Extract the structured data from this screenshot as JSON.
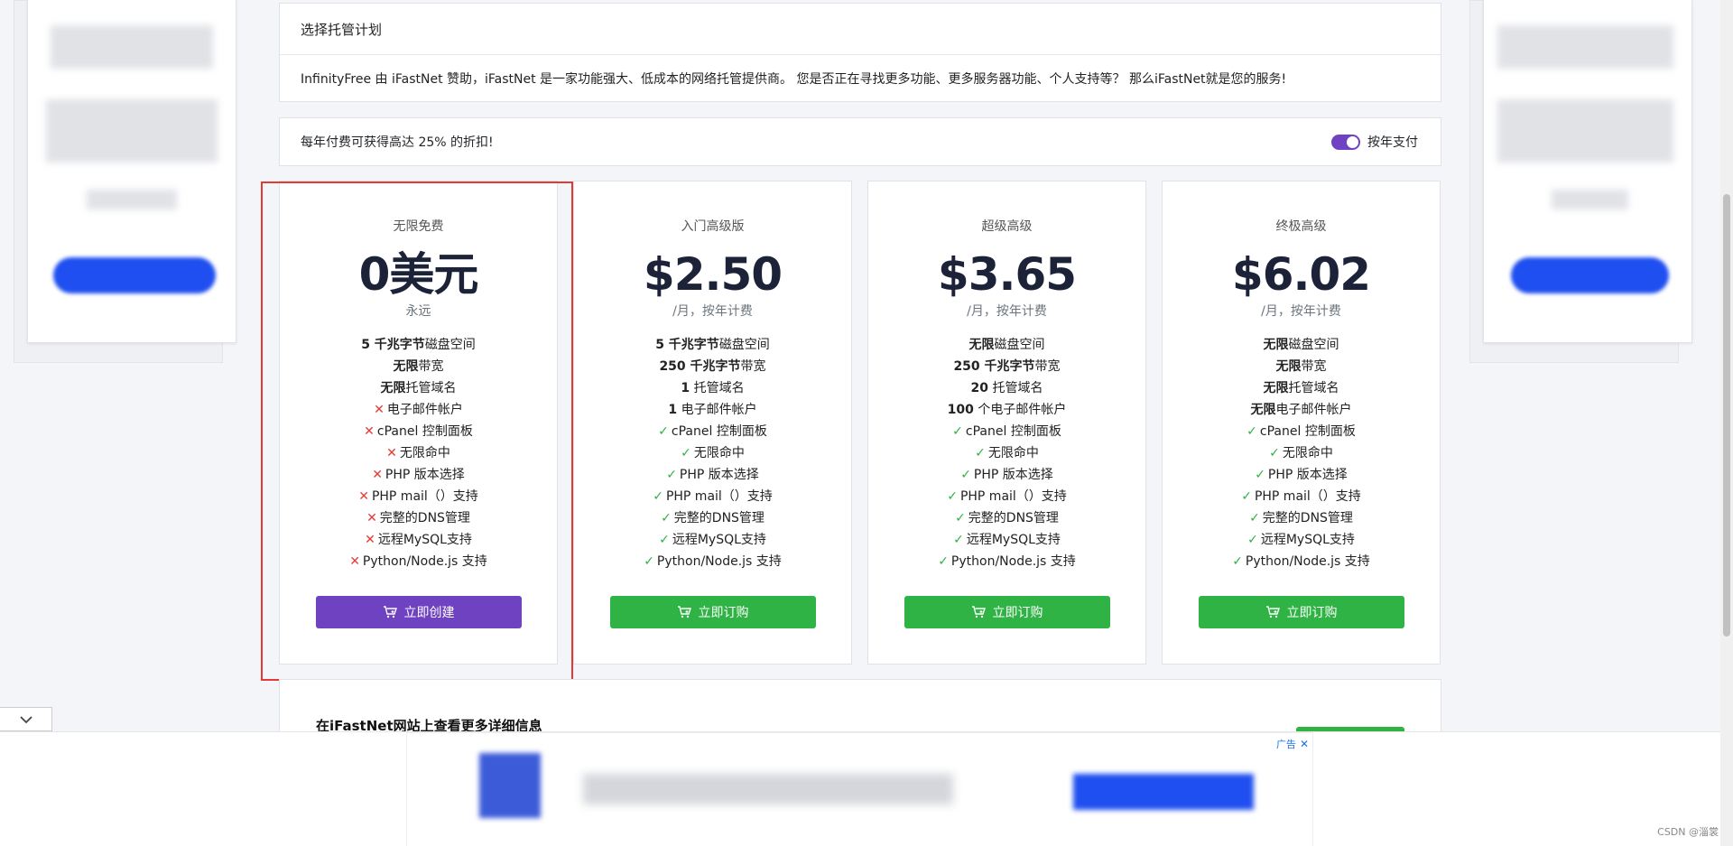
{
  "section_title": "选择托管计划",
  "intro_text": "InfinityFree 由 iFastNet 赞助，iFastNet 是一家功能强大、低成本的网络托管提供商。 您是否正在寻找更多功能、更多服务器功能、个人支持等？ 那么iFastNet就是您的服务!",
  "discount": {
    "text": "每年付费可获得高达 25% 的折扣!",
    "toggle_label": "按年支付",
    "toggle_on": true
  },
  "colors": {
    "purple": "#6f42c1",
    "green": "#2fb344",
    "red": "#e53935"
  },
  "plans": [
    {
      "name": "无限免费",
      "price": "0美元",
      "period": "永远",
      "features": [
        {
          "strong": "5 千兆字节",
          "text": "磁盘空间",
          "mark": "none"
        },
        {
          "strong": "无限",
          "text": "带宽",
          "mark": "none"
        },
        {
          "strong": "无限",
          "text": "托管域名",
          "mark": "none"
        },
        {
          "strong": "",
          "text": "电子邮件帐户",
          "mark": "no"
        },
        {
          "strong": "",
          "text": "cPanel 控制面板",
          "mark": "no"
        },
        {
          "strong": "",
          "text": "无限命中",
          "mark": "no"
        },
        {
          "strong": "",
          "text": "PHP 版本选择",
          "mark": "no"
        },
        {
          "strong": "",
          "text": "PHP mail（）支持",
          "mark": "no"
        },
        {
          "strong": "",
          "text": "完整的DNS管理",
          "mark": "no"
        },
        {
          "strong": "",
          "text": "远程MySQL支持",
          "mark": "no"
        },
        {
          "strong": "",
          "text": "Python/Node.js 支持",
          "mark": "no"
        }
      ],
      "button": "立即创建"
    },
    {
      "name": "入门高级版",
      "price": "$2.50",
      "period": "/月，按年计费",
      "features": [
        {
          "strong": "5 千兆字节",
          "text": "磁盘空间",
          "mark": "none"
        },
        {
          "strong": "250 千兆字节",
          "text": "带宽",
          "mark": "none"
        },
        {
          "strong": "1",
          "text": " 托管域名",
          "mark": "none"
        },
        {
          "strong": "1",
          "text": " 电子邮件帐户",
          "mark": "none"
        },
        {
          "strong": "",
          "text": "cPanel 控制面板",
          "mark": "yes"
        },
        {
          "strong": "",
          "text": "无限命中",
          "mark": "yes"
        },
        {
          "strong": "",
          "text": "PHP 版本选择",
          "mark": "yes"
        },
        {
          "strong": "",
          "text": "PHP mail（）支持",
          "mark": "yes"
        },
        {
          "strong": "",
          "text": "完整的DNS管理",
          "mark": "yes"
        },
        {
          "strong": "",
          "text": "远程MySQL支持",
          "mark": "yes"
        },
        {
          "strong": "",
          "text": "Python/Node.js 支持",
          "mark": "yes"
        }
      ],
      "button": "立即订购"
    },
    {
      "name": "超级高级",
      "price": "$3.65",
      "period": "/月，按年计费",
      "features": [
        {
          "strong": "无限",
          "text": "磁盘空间",
          "mark": "none"
        },
        {
          "strong": "250 千兆字节",
          "text": "带宽",
          "mark": "none"
        },
        {
          "strong": "20",
          "text": " 托管域名",
          "mark": "none"
        },
        {
          "strong": "100",
          "text": " 个电子邮件帐户",
          "mark": "none"
        },
        {
          "strong": "",
          "text": "cPanel 控制面板",
          "mark": "yes"
        },
        {
          "strong": "",
          "text": "无限命中",
          "mark": "yes"
        },
        {
          "strong": "",
          "text": "PHP 版本选择",
          "mark": "yes"
        },
        {
          "strong": "",
          "text": "PHP mail（）支持",
          "mark": "yes"
        },
        {
          "strong": "",
          "text": "完整的DNS管理",
          "mark": "yes"
        },
        {
          "strong": "",
          "text": "远程MySQL支持",
          "mark": "yes"
        },
        {
          "strong": "",
          "text": "Python/Node.js 支持",
          "mark": "yes"
        }
      ],
      "button": "立即订购"
    },
    {
      "name": "终极高级",
      "price": "$6.02",
      "period": "/月，按年计费",
      "features": [
        {
          "strong": "无限",
          "text": "磁盘空间",
          "mark": "none"
        },
        {
          "strong": "无限",
          "text": "带宽",
          "mark": "none"
        },
        {
          "strong": "无限",
          "text": "托管域名",
          "mark": "none"
        },
        {
          "strong": "无限",
          "text": "电子邮件帐户",
          "mark": "none"
        },
        {
          "strong": "",
          "text": "cPanel 控制面板",
          "mark": "yes"
        },
        {
          "strong": "",
          "text": "无限命中",
          "mark": "yes"
        },
        {
          "strong": "",
          "text": "PHP 版本选择",
          "mark": "yes"
        },
        {
          "strong": "",
          "text": "PHP mail（）支持",
          "mark": "yes"
        },
        {
          "strong": "",
          "text": "完整的DNS管理",
          "mark": "yes"
        },
        {
          "strong": "",
          "text": "远程MySQL支持",
          "mark": "yes"
        },
        {
          "strong": "",
          "text": "Python/Node.js 支持",
          "mark": "yes"
        }
      ],
      "button": "立即订购"
    }
  ],
  "more_info": "在iFastNet网站上查看更多详细信息",
  "ad": {
    "label": "广告",
    "close": "✕"
  },
  "watermark": "CSDN @淄裳",
  "icons": {
    "collapse": "chevron-down-icon",
    "cart": "cart-icon",
    "check": "check-icon",
    "cross": "cross-icon"
  }
}
